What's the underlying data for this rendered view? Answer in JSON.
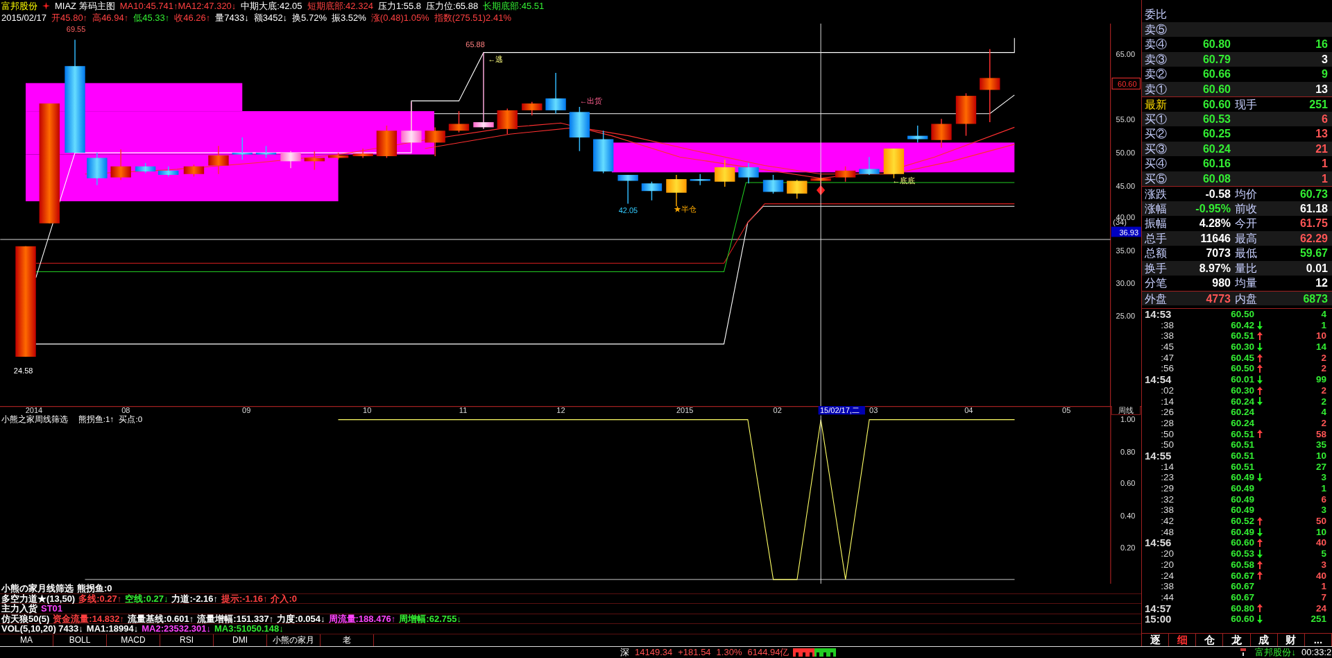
{
  "header": {
    "line1": [
      {
        "text": "富邦股份",
        "color": "#ffff00"
      },
      {
        "text": "MIAZ 筹码主图",
        "color": "#ffffff"
      },
      {
        "text": "MA10:45.741↑MA12:47.320↓",
        "color": "#ff4040"
      },
      {
        "text": "中期大底:42.05",
        "color": "#ffffff"
      },
      {
        "text": "短期底部:42.324",
        "color": "#ff4040"
      },
      {
        "text": "压力1:55.8",
        "color": "#ffffff"
      },
      {
        "text": "压力位:65.88",
        "color": "#ffffff"
      },
      {
        "text": "长期底部:45.51",
        "color": "#33ee33"
      }
    ],
    "line2": [
      {
        "text": "2015/02/17",
        "color": "#ffffff"
      },
      {
        "text": "开45.80↑",
        "color": "#ff4040"
      },
      {
        "text": "高46.94↑",
        "color": "#ff4040"
      },
      {
        "text": "低45.33↑",
        "color": "#33ee33"
      },
      {
        "text": "收46.26↑",
        "color": "#ff4040"
      },
      {
        "text": "量7433↓",
        "color": "#ffffff"
      },
      {
        "text": "额3452↓",
        "color": "#ffffff"
      },
      {
        "text": "换5.72%",
        "color": "#ffffff"
      },
      {
        "text": "振3.52%",
        "color": "#ffffff"
      },
      {
        "text": "涨(0.48)1.05%",
        "color": "#ff4040"
      },
      {
        "text": "指数(275.51)2.41%",
        "color": "#ff4040"
      }
    ]
  },
  "main_chart": {
    "y_axis_labels": [
      "65.00",
      "55.00",
      "50.00",
      "45.00",
      "40.00",
      "35.00",
      "30.00",
      "25.00"
    ],
    "price_tag": "60.60",
    "cursor_count": "(34)",
    "cursor_price": "36.93",
    "annotations": [
      "69.55",
      "65.88",
      "←逃",
      "←出货",
      "42.05",
      "★半仓",
      "←底底",
      "24.58"
    ],
    "x_axis_labels": [
      {
        "text": "2014",
        "selected": false
      },
      {
        "text": "08",
        "selected": false
      },
      {
        "text": "09",
        "selected": false
      },
      {
        "text": "10",
        "selected": false
      },
      {
        "text": "11",
        "selected": false
      },
      {
        "text": "12",
        "selected": false
      },
      {
        "text": "2015",
        "selected": false
      },
      {
        "text": "02",
        "selected": false
      },
      {
        "text": "15/02/17,二",
        "selected": true
      },
      {
        "text": "03",
        "selected": false
      },
      {
        "text": "04",
        "selected": false
      },
      {
        "text": "05",
        "selected": false
      }
    ],
    "period": "周线"
  },
  "lower_panel": {
    "title": "小熊之家周线筛选",
    "values": [
      "熊拐鱼:1↑",
      "买点:0"
    ],
    "y_axis_labels": [
      "1.00",
      "0.80",
      "0.60",
      "0.40",
      "0.20"
    ]
  },
  "indicator_rows": [
    [
      {
        "text": "小熊の家月线筛选",
        "color": "#ffffff"
      },
      {
        "text": "熊拐鱼:0",
        "color": "#ffffff"
      }
    ],
    [
      {
        "text": "多空力道★(13,50)",
        "color": "#ffffff"
      },
      {
        "text": "多线:0.27↑",
        "color": "#ff4040"
      },
      {
        "text": "空线:0.27↓",
        "color": "#33ee33"
      },
      {
        "text": "力道:-2.16↑",
        "color": "#ffffff"
      },
      {
        "text": "提示:-1.16↑",
        "color": "#ff4040"
      },
      {
        "text": "介入:0",
        "color": "#ff4040"
      }
    ],
    [
      {
        "text": "主力入货",
        "color": "#ffffff"
      },
      {
        "text": "ST01",
        "color": "#ff44ff"
      }
    ],
    [
      {
        "text": "仿天狼50(5)",
        "color": "#ffffff"
      },
      {
        "text": "资金流量:14.832↑",
        "color": "#ff4040"
      },
      {
        "text": "流量基线:0.601↑",
        "color": "#ffffff"
      },
      {
        "text": "流量增幅:151.337↑",
        "color": "#ffffff"
      },
      {
        "text": "力度:0.054↓",
        "color": "#ffffff"
      },
      {
        "text": "周流量:188.476↑",
        "color": "#ff44ff"
      },
      {
        "text": "周增幅:62.755↓",
        "color": "#33ee33"
      }
    ],
    [
      {
        "text": "VOL(5,10,20) 7433↓",
        "color": "#ffffff"
      },
      {
        "text": "MA1:18994↓",
        "color": "#ffffff"
      },
      {
        "text": "MA2:23532.301↓",
        "color": "#ff44ff"
      },
      {
        "text": "MA3:51050.148↓",
        "color": "#33ee33"
      }
    ]
  ],
  "indicator_tabs": [
    "MA",
    "BOLL",
    "MACD",
    "RSI",
    "DMI",
    "小熊の家月",
    "老"
  ],
  "quote": {
    "title": "委比",
    "order_book": [
      {
        "label": "卖⑤"
      },
      {
        "label": "卖④",
        "price": "60.80",
        "volume": "16",
        "color": "#33ee33"
      },
      {
        "label": "卖③",
        "price": "60.79",
        "volume": "3",
        "color": "#ffffff"
      },
      {
        "label": "卖②",
        "price": "60.66",
        "volume": "9",
        "color": "#33ee33"
      },
      {
        "label": "卖①",
        "price": "60.60",
        "volume": "13",
        "color": "#ffffff"
      },
      {
        "label": "最新",
        "price": "60.60",
        "label2": "现手",
        "volume": "251",
        "color": "#33ee33"
      },
      {
        "label": "买①",
        "price": "60.53",
        "volume": "6",
        "color": "#ff5555"
      },
      {
        "label": "买②",
        "price": "60.25",
        "volume": "13",
        "color": "#ff5555"
      },
      {
        "label": "买③",
        "price": "60.24",
        "volume": "21",
        "color": "#ff5555"
      },
      {
        "label": "买④",
        "price": "60.16",
        "volume": "1",
        "color": "#ff5555"
      },
      {
        "label": "买⑤",
        "price": "60.08",
        "volume": "1",
        "color": "#ff5555"
      }
    ],
    "stats": [
      [
        {
          "label": "涨跌",
          "value": "-0.58",
          "color": "#ffffff"
        },
        {
          "label": "均价",
          "value": "60.73",
          "color": "#33ee33"
        }
      ],
      [
        {
          "label": "涨幅",
          "value": "-0.95%",
          "color": "#33ee33"
        },
        {
          "label": "前收",
          "value": "61.18",
          "color": "#ffffff"
        }
      ],
      [
        {
          "label": "振幅",
          "value": "4.28%",
          "color": "#ffffff"
        },
        {
          "label": "今开",
          "value": "61.75",
          "color": "#ff5555"
        }
      ],
      [
        {
          "label": "总手",
          "value": "11646",
          "color": "#ffffff"
        },
        {
          "label": "最高",
          "value": "62.29",
          "color": "#ff5555"
        }
      ],
      [
        {
          "label": "总额",
          "value": "7073",
          "color": "#ffffff"
        },
        {
          "label": "最低",
          "value": "59.67",
          "color": "#33ee33"
        }
      ],
      [
        {
          "label": "换手",
          "value": "8.97%",
          "color": "#ffffff"
        },
        {
          "label": "量比",
          "value": "0.01",
          "color": "#ffffff"
        }
      ],
      [
        {
          "label": "分笔",
          "value": "980",
          "color": "#ffffff"
        },
        {
          "label": "均量",
          "value": "12",
          "color": "#ffffff"
        }
      ],
      [
        {
          "label": "外盘",
          "value": "4773",
          "color": "#ff5555"
        },
        {
          "label": "内盘",
          "value": "6873",
          "color": "#33ee33"
        }
      ]
    ],
    "ticks": [
      {
        "kind": "minute",
        "time": "14:53",
        "price": "60.50",
        "volume": "4",
        "color": "#33ee33"
      },
      {
        "kind": "second",
        "time": ":38",
        "price": "60.42",
        "arrow": {
          "kind": "down"
        },
        "volume": "1",
        "color": "#33ee33"
      },
      {
        "kind": "second",
        "time": ":38",
        "price": "60.51",
        "arrow": {
          "kind": "up"
        },
        "volume": "10",
        "color": "#ff5555"
      },
      {
        "kind": "second",
        "time": ":45",
        "price": "60.30",
        "arrow": {
          "kind": "down"
        },
        "volume": "14",
        "color": "#33ee33"
      },
      {
        "kind": "second",
        "time": ":47",
        "price": "60.45",
        "arrow": {
          "kind": "up"
        },
        "volume": "2",
        "color": "#ff5555"
      },
      {
        "kind": "second",
        "time": ":56",
        "price": "60.50",
        "arrow": {
          "kind": "up"
        },
        "volume": "2",
        "color": "#ff5555"
      },
      {
        "kind": "minute",
        "time": "14:54",
        "price": "60.01",
        "arrow": {
          "kind": "down"
        },
        "volume": "99",
        "color": "#33ee33"
      },
      {
        "kind": "second",
        "time": ":02",
        "price": "60.30",
        "arrow": {
          "kind": "up"
        },
        "volume": "2",
        "color": "#ff5555"
      },
      {
        "kind": "second",
        "time": ":14",
        "price": "60.24",
        "arrow": {
          "kind": "down"
        },
        "volume": "2",
        "color": "#33ee33"
      },
      {
        "kind": "second",
        "time": ":26",
        "price": "60.24",
        "volume": "4",
        "color": "#33ee33"
      },
      {
        "kind": "second",
        "time": ":28",
        "price": "60.24",
        "volume": "2",
        "color": "#ff5555"
      },
      {
        "kind": "second",
        "time": ":50",
        "price": "60.51",
        "arrow": {
          "kind": "up"
        },
        "volume": "58",
        "color": "#ff5555"
      },
      {
        "kind": "second",
        "time": ":50",
        "price": "60.51",
        "volume": "35",
        "color": "#33ee33"
      },
      {
        "kind": "minute",
        "time": "14:55",
        "price": "60.51",
        "volume": "10",
        "color": "#33ee33"
      },
      {
        "kind": "second",
        "time": ":14",
        "price": "60.51",
        "volume": "27",
        "color": "#33ee33"
      },
      {
        "kind": "second",
        "time": ":23",
        "price": "60.49",
        "arrow": {
          "kind": "down"
        },
        "volume": "3",
        "color": "#33ee33"
      },
      {
        "kind": "second",
        "time": ":29",
        "price": "60.49",
        "volume": "1",
        "color": "#33ee33"
      },
      {
        "kind": "second",
        "time": ":32",
        "price": "60.49",
        "volume": "6",
        "color": "#ff5555"
      },
      {
        "kind": "second",
        "time": ":38",
        "price": "60.49",
        "volume": "3",
        "color": "#33ee33"
      },
      {
        "kind": "second",
        "time": ":42",
        "price": "60.52",
        "arrow": {
          "kind": "up"
        },
        "volume": "50",
        "color": "#ff5555"
      },
      {
        "kind": "second",
        "time": ":48",
        "price": "60.49",
        "arrow": {
          "kind": "down"
        },
        "volume": "10",
        "color": "#33ee33"
      },
      {
        "kind": "minute",
        "time": "14:56",
        "price": "60.60",
        "arrow": {
          "kind": "up"
        },
        "volume": "40",
        "color": "#ff5555"
      },
      {
        "kind": "second",
        "time": ":20",
        "price": "60.53",
        "arrow": {
          "kind": "down"
        },
        "volume": "5",
        "color": "#33ee33"
      },
      {
        "kind": "second",
        "time": ":20",
        "price": "60.58",
        "arrow": {
          "kind": "up"
        },
        "volume": "3",
        "color": "#ff5555"
      },
      {
        "kind": "second",
        "time": ":24",
        "price": "60.67",
        "arrow": {
          "kind": "up"
        },
        "volume": "40",
        "color": "#ff5555"
      },
      {
        "kind": "second",
        "time": ":38",
        "price": "60.67",
        "volume": "1",
        "color": "#ff5555"
      },
      {
        "kind": "second",
        "time": ":44",
        "price": "60.67",
        "volume": "7",
        "color": "#ff5555"
      },
      {
        "kind": "minute",
        "time": "14:57",
        "price": "60.80",
        "arrow": {
          "kind": "up"
        },
        "volume": "24",
        "color": "#ff5555"
      },
      {
        "kind": "minute",
        "time": "15:00",
        "price": "60.60",
        "arrow": {
          "kind": "down"
        },
        "volume": "251",
        "color": "#33ee33"
      }
    ],
    "tabs": [
      {
        "label": "逐",
        "selected": false
      },
      {
        "label": "细",
        "selected": true
      },
      {
        "label": "仓",
        "selected": false
      },
      {
        "label": "龙",
        "selected": false
      },
      {
        "label": "成",
        "selected": false
      },
      {
        "label": "财",
        "selected": false
      },
      {
        "label": "...",
        "selected": false
      }
    ]
  },
  "status_bar": {
    "market": "深",
    "index": "14149.34",
    "change": "+181.54",
    "percent": "1.30%",
    "amount": "6144.94亿",
    "stock": "富邦股份↓",
    "time": "00:33:2"
  }
}
